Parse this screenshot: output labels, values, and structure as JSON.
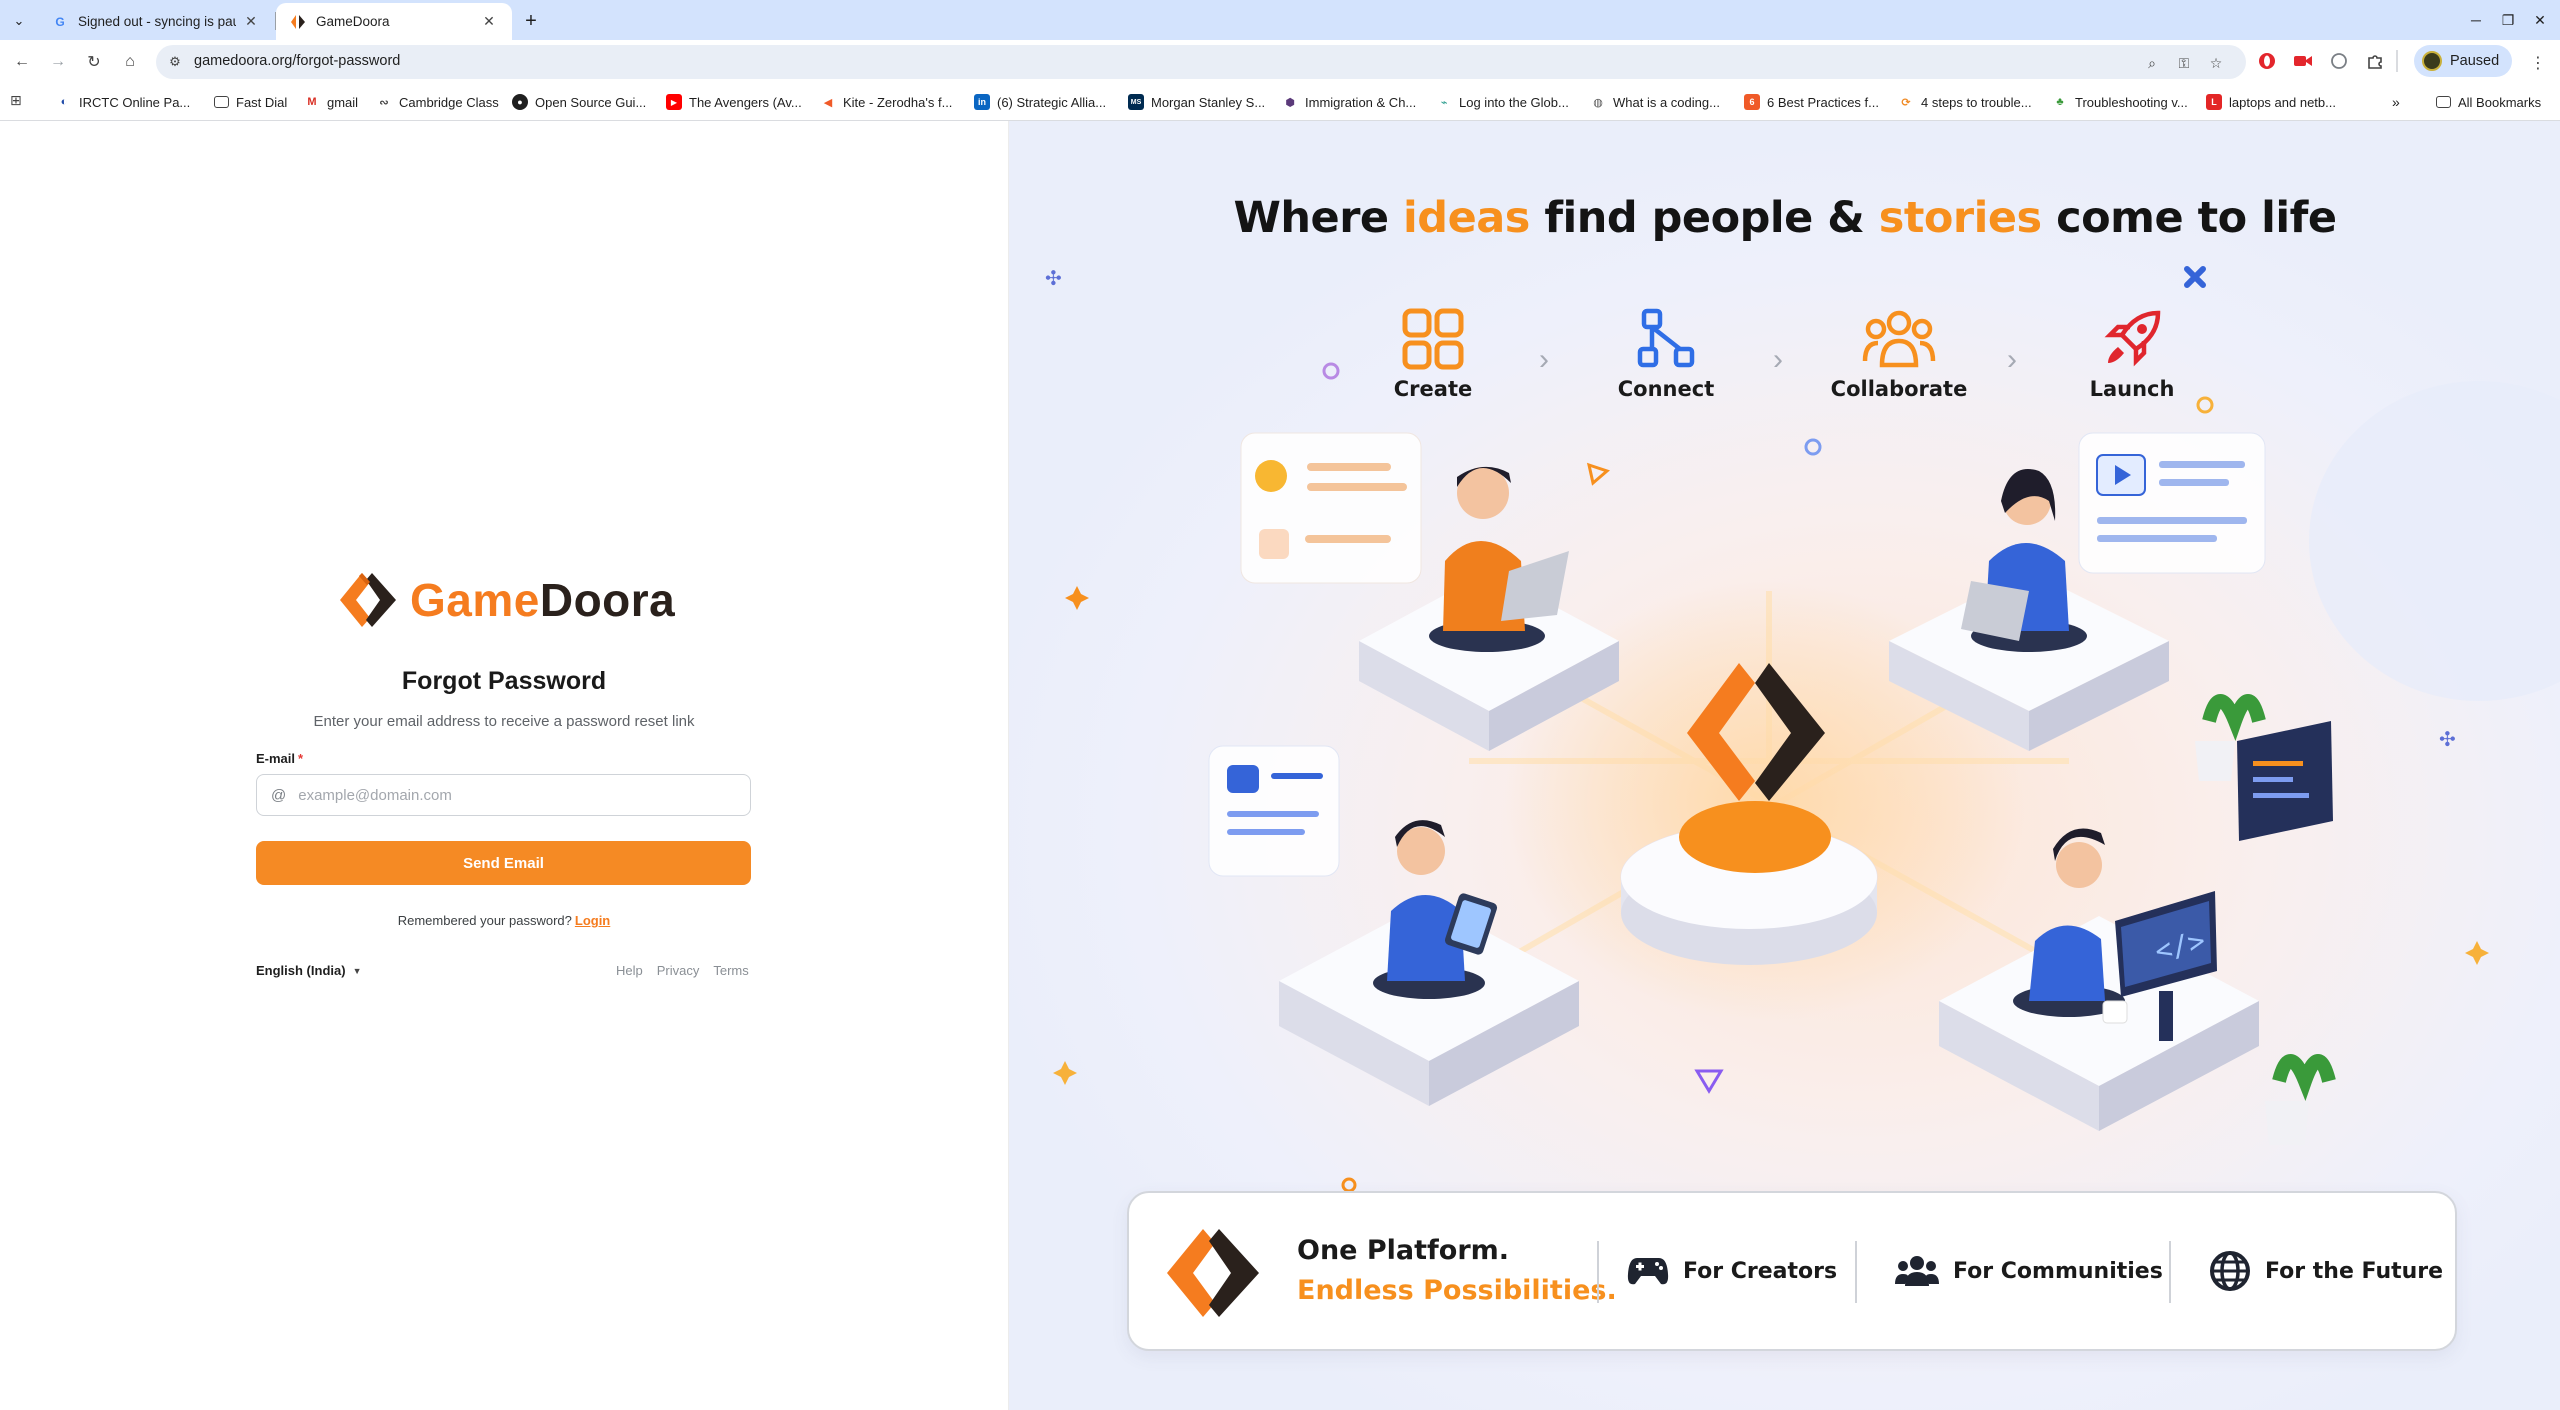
{
  "browser": {
    "tabs": [
      {
        "title": "Signed out - syncing is paused",
        "active": false
      },
      {
        "title": "GameDoora",
        "active": true
      }
    ],
    "url": "gamedoora.org/forgot-password",
    "profile_label": "Paused",
    "bookmarks": [
      "IRCTC Online Pa...",
      "Fast Dial",
      "gmail",
      "Cambridge Class",
      "Open Source Gui...",
      "The Avengers (Av...",
      "Kite - Zerodha's f...",
      "(6) Strategic Allia...",
      "Morgan Stanley S...",
      "Immigration & Ch...",
      "Log into the Glob...",
      "What is a coding...",
      "6 Best Practices f...",
      "4 steps to trouble...",
      "Troubleshooting v...",
      "laptops and netb..."
    ],
    "all_bookmarks_label": "All Bookmarks"
  },
  "brand": {
    "name_part1": "Game",
    "name_part2": "Doora",
    "orange": "#F57C1F",
    "dark": "#2A211C"
  },
  "form": {
    "title": "Forgot Password",
    "subtitle": "Enter your email address to receive a password reset link",
    "email_label": "E-mail",
    "required_mark": "*",
    "email_placeholder": "example@domain.com",
    "email_value": "",
    "submit_label": "Send Email",
    "remember_text": "Remembered your password?",
    "login_link": "Login",
    "language": "English (India)",
    "footer_links": [
      "Help",
      "Privacy",
      "Terms"
    ]
  },
  "hero": {
    "title_parts": [
      "Where ",
      "ideas",
      " find people & ",
      "stories",
      " come to life"
    ],
    "steps": [
      {
        "label": "Create",
        "icon": "grid-icon"
      },
      {
        "label": "Connect",
        "icon": "network-icon"
      },
      {
        "label": "Collaborate",
        "icon": "team-icon"
      },
      {
        "label": "Launch",
        "icon": "rocket-icon"
      }
    ],
    "banner": {
      "line1": "One Platform.",
      "line2": "Endless Possibilities.",
      "features": [
        {
          "label": "For Creators",
          "icon": "gamepad-icon"
        },
        {
          "label": "For Communities",
          "icon": "people-icon"
        },
        {
          "label": "For the Future",
          "icon": "globe-icon"
        }
      ]
    }
  }
}
